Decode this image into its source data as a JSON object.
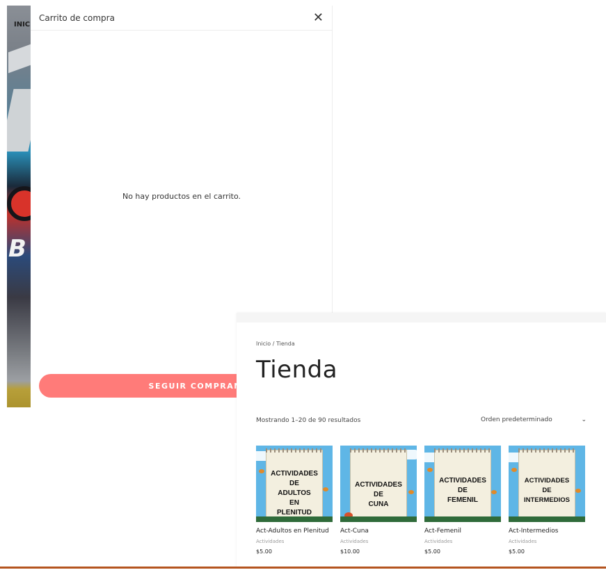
{
  "background": {
    "nav_text": "INIC"
  },
  "cart": {
    "title": "Carrito de compra",
    "empty_message": "No hay productos en el carrito.",
    "continue_label": "SEGUIR COMPRANDO"
  },
  "shop": {
    "breadcrumb": "Inicio / Tienda",
    "title": "Tienda",
    "result_count": "Mostrando 1–20 de 90 resultados",
    "orderby_selected": "Orden predeterminado",
    "products": [
      {
        "name": "Act-Adultos en Plenitud",
        "category": "Actividades",
        "price": "$5.00",
        "thumb_lines": [
          "ACTIVIDADES",
          "DE",
          "ADULTOS",
          "EN",
          "PLENITUD"
        ]
      },
      {
        "name": "Act-Cuna",
        "category": "Actividades",
        "price": "$10.00",
        "thumb_lines": [
          "ACTIVIDADES",
          "DE",
          "CUNA"
        ]
      },
      {
        "name": "Act-Femenil",
        "category": "Actividades",
        "price": "$5.00",
        "thumb_lines": [
          "ACTIVIDADES",
          "DE",
          "FEMENIL"
        ]
      },
      {
        "name": "Act-Intermedios",
        "category": "Actividades",
        "price": "$5.00",
        "thumb_lines": [
          "ACTIVIDADES",
          "DE",
          "INTERMEDIOS"
        ]
      }
    ]
  },
  "colors": {
    "accent_button": "#ff7b79",
    "bottom_line": "#b4541f"
  }
}
